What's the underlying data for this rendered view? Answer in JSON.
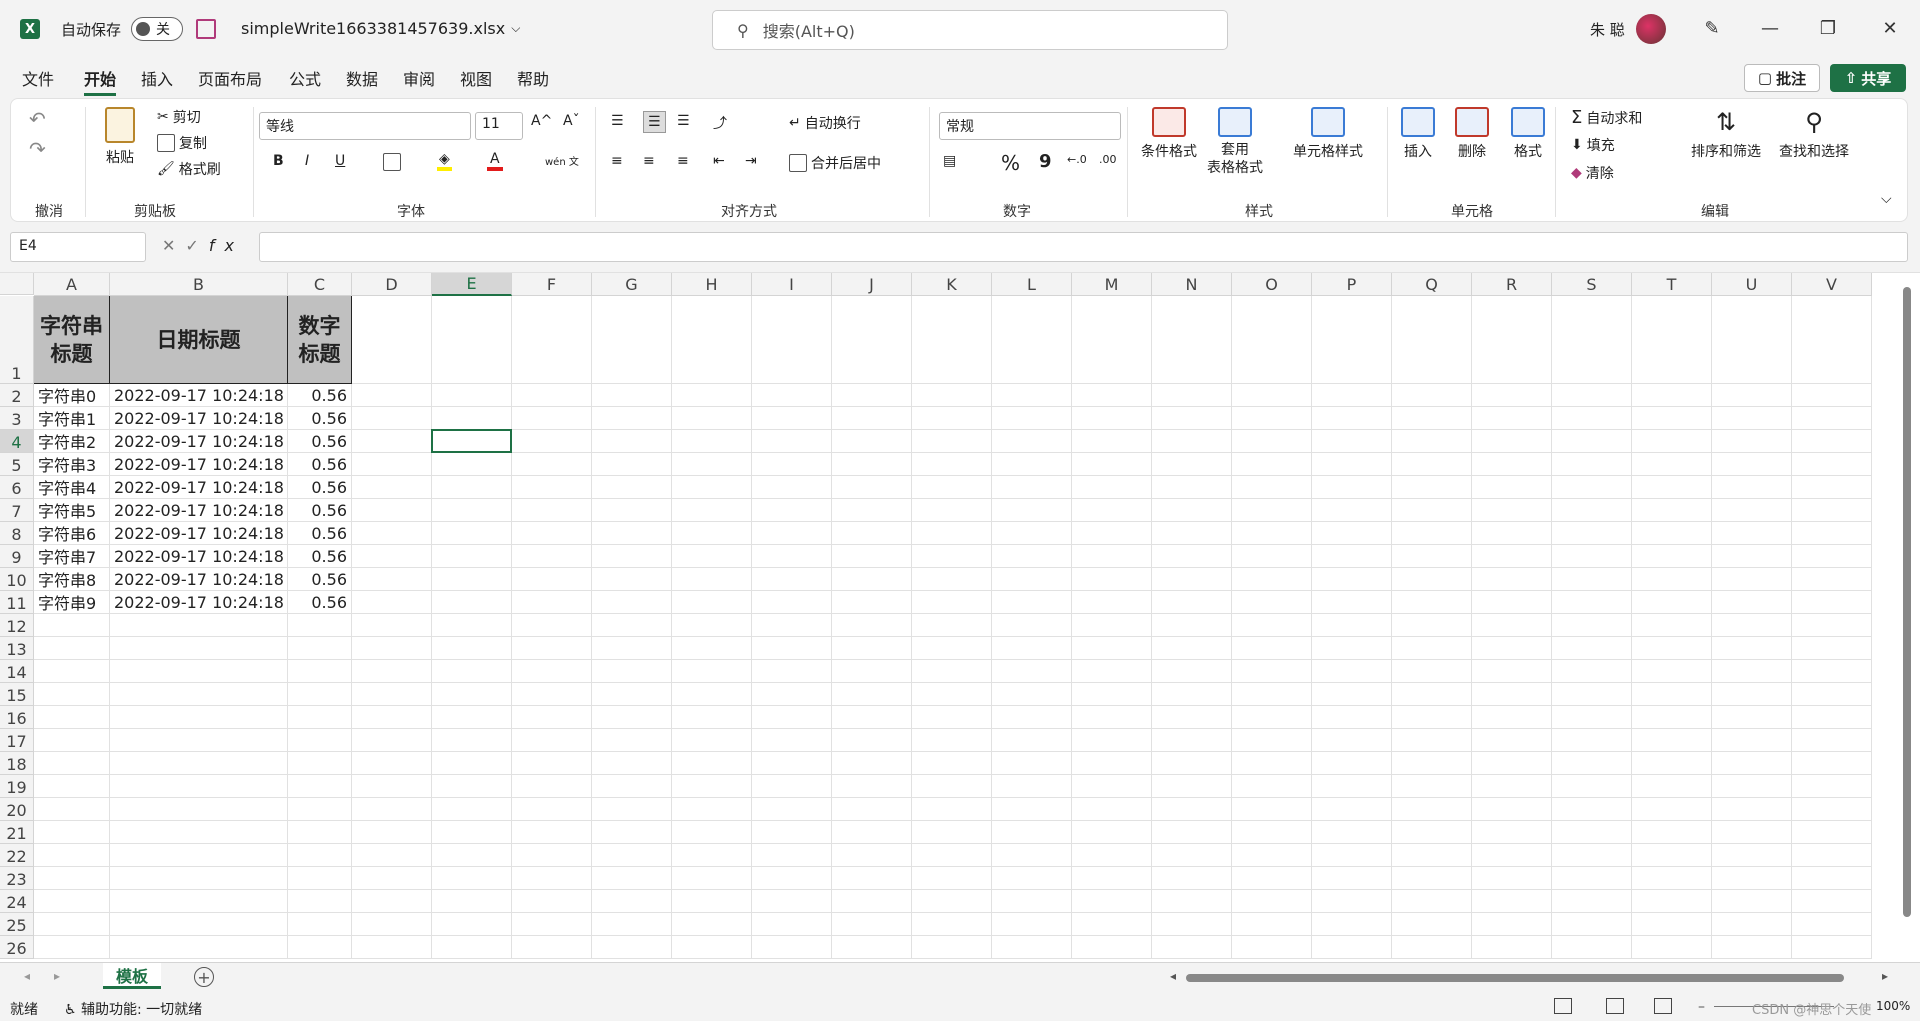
{
  "titlebar": {
    "app_icon": "excel-icon",
    "app_letter": "X",
    "autosave_label": "自动保存",
    "autosave_state": "关",
    "filename": "simpleWrite1663381457639.xlsx",
    "search_placeholder": "搜索(Alt+Q)",
    "user_name": "朱 聪"
  },
  "menu": [
    "文件",
    "开始",
    "插入",
    "页面布局",
    "公式",
    "数据",
    "审阅",
    "视图",
    "帮助"
  ],
  "menu_active": "开始",
  "actions": {
    "comment": "批注",
    "share": "共享"
  },
  "ribbon": {
    "undo_group": "撤消",
    "clipboard": {
      "paste": "粘贴",
      "cut": "剪切",
      "copy": "复制",
      "format_painter": "格式刷",
      "label": "剪贴板"
    },
    "font": {
      "name": "等线",
      "size": "11",
      "label": "字体",
      "bold": "B",
      "italic": "I",
      "underline": "U",
      "grow": "A^",
      "shrink": "Aˇ",
      "phonetic": "wén 文"
    },
    "alignment": {
      "wrap": "自动换行",
      "merge": "合并后居中",
      "label": "对齐方式"
    },
    "number": {
      "format": "常规",
      "label": "数字",
      "percent": "%",
      "comma": "9"
    },
    "styles": {
      "conditional": "条件格式",
      "table_line1": "套用",
      "table_line2": "表格格式",
      "cell_styles": "单元格样式",
      "label": "样式"
    },
    "cells": {
      "insert": "插入",
      "delete": "删除",
      "format": "格式",
      "label": "单元格"
    },
    "editing": {
      "autosum": "自动求和",
      "fill": "填充",
      "clear": "清除",
      "sort": "排序和筛选",
      "find": "查找和选择",
      "label": "编辑"
    }
  },
  "formula_bar": {
    "name_box": "E4",
    "fx": "fx",
    "value": ""
  },
  "columns": [
    "A",
    "B",
    "C",
    "D",
    "E",
    "F",
    "G",
    "H",
    "I",
    "J",
    "K",
    "L",
    "M",
    "N",
    "O",
    "P",
    "Q",
    "R",
    "S",
    "T",
    "U",
    "V"
  ],
  "rows": [
    "1",
    "2",
    "3",
    "4",
    "5",
    "6",
    "7",
    "8",
    "9",
    "10",
    "11",
    "12",
    "13",
    "14",
    "15",
    "16",
    "17",
    "18",
    "19",
    "20",
    "21",
    "22",
    "23",
    "24",
    "25",
    "26"
  ],
  "selected": {
    "column": "E",
    "row": "4"
  },
  "sheet": {
    "headers": [
      "字符串标题",
      "日期标题",
      "数字标题"
    ],
    "data": [
      [
        "字符串0",
        "2022-09-17 10:24:18",
        "0.56"
      ],
      [
        "字符串1",
        "2022-09-17 10:24:18",
        "0.56"
      ],
      [
        "字符串2",
        "2022-09-17 10:24:18",
        "0.56"
      ],
      [
        "字符串3",
        "2022-09-17 10:24:18",
        "0.56"
      ],
      [
        "字符串4",
        "2022-09-17 10:24:18",
        "0.56"
      ],
      [
        "字符串5",
        "2022-09-17 10:24:18",
        "0.56"
      ],
      [
        "字符串6",
        "2022-09-17 10:24:18",
        "0.56"
      ],
      [
        "字符串7",
        "2022-09-17 10:24:18",
        "0.56"
      ],
      [
        "字符串8",
        "2022-09-17 10:24:18",
        "0.56"
      ],
      [
        "字符串9",
        "2022-09-17 10:24:18",
        "0.56"
      ]
    ]
  },
  "sheet_tabs": [
    "模板"
  ],
  "status": {
    "ready": "就绪",
    "accessibility": "辅助功能: 一切就绪",
    "zoom": "100%",
    "watermark": "CSDN @神思个天使"
  },
  "colors": {
    "accent": "#1e7145",
    "header_fill": "#c0c0c0"
  }
}
